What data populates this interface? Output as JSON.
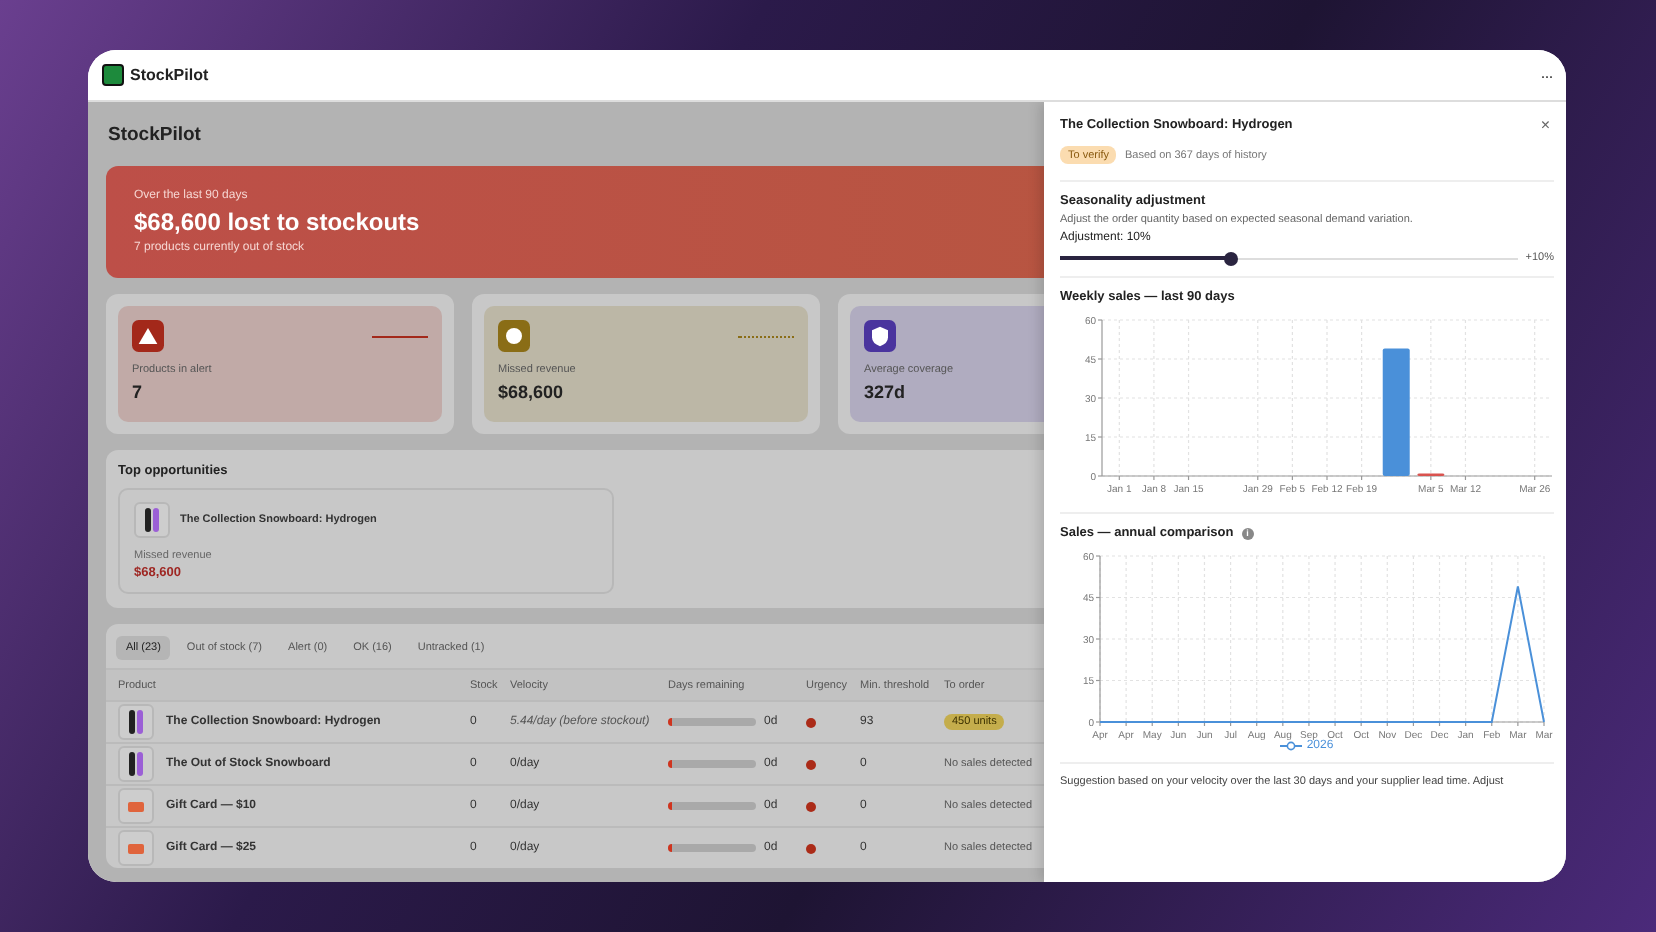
{
  "window": {
    "title": "StockPilot",
    "menu": "···"
  },
  "page": {
    "title": "StockPilot"
  },
  "hero": {
    "eyebrow": "Over the last 90 days",
    "headline": "$68,600 lost to stockouts",
    "subtitle": "7 products currently out of stock"
  },
  "stats": [
    {
      "kind": "alert",
      "label": "Products in alert",
      "value": "7",
      "color": "#a3281a"
    },
    {
      "kind": "revenue",
      "label": "Missed revenue",
      "value": "$68,600",
      "color": "#8a6d16"
    },
    {
      "kind": "coverage",
      "label": "Average coverage",
      "value": "327d",
      "color": "#4a349e"
    }
  ],
  "opportunities": {
    "title": "Top opportunities",
    "items": [
      {
        "product": "The Collection Snowboard: Hydrogen",
        "metric_label": "Missed revenue",
        "metric_value": "$68,600"
      }
    ]
  },
  "filters": [
    {
      "label": "All (23)",
      "selected": true
    },
    {
      "label": "Out of stock (7)",
      "selected": false
    },
    {
      "label": "Alert (0)",
      "selected": false
    },
    {
      "label": "OK (16)",
      "selected": false
    },
    {
      "label": "Untracked (1)",
      "selected": false
    }
  ],
  "table": {
    "columns": [
      "Product",
      "Stock",
      "Velocity",
      "Days remaining",
      "Urgency",
      "Min. threshold",
      "To order"
    ],
    "rows": [
      {
        "kind": "snowboard",
        "product": "The Collection Snowboard: Hydrogen",
        "stock": "0",
        "velocity": "5.44/day (before stockout)",
        "estimated": true,
        "level": 0.04,
        "days": "0d",
        "color": "#ab2b18",
        "threshold": "93",
        "to_order": {
          "kind": "badge",
          "text": "450 units"
        }
      },
      {
        "kind": "snowboard",
        "product": "The Out of Stock Snowboard",
        "stock": "0",
        "velocity": "0/day",
        "estimated": false,
        "level": 0.04,
        "days": "0d",
        "color": "#ab2b18",
        "threshold": "0",
        "to_order": {
          "kind": "note",
          "text": "No sales detected"
        }
      },
      {
        "kind": "giftcard",
        "product": "Gift Card — $10",
        "stock": "0",
        "velocity": "0/day",
        "estimated": false,
        "level": 0.04,
        "days": "0d",
        "color": "#ab2b18",
        "threshold": "0",
        "to_order": {
          "kind": "note",
          "text": "No sales detected"
        }
      },
      {
        "kind": "giftcard",
        "product": "Gift Card — $25",
        "stock": "0",
        "velocity": "0/day",
        "estimated": false,
        "level": 0.04,
        "days": "0d",
        "color": "#ab2b18",
        "threshold": "0",
        "to_order": {
          "kind": "note",
          "text": "No sales detected"
        }
      }
    ]
  },
  "panel": {
    "title": "The Collection Snowboard: Hydrogen",
    "close": "×",
    "badge": "To verify",
    "history": "Based on 367 days of history",
    "seasonality": {
      "title": "Seasonality adjustment",
      "description": "Adjust the order quantity based on expected seasonal demand variation.",
      "label": "Adjustment: 10%",
      "level": 0.375,
      "reading": "+10%"
    },
    "weekly": {
      "title": "Weekly sales — last 90 days",
      "chart_data": {
        "type": "bar",
        "grid": true,
        "categories": [
          "Jan 1",
          "Jan 8",
          "Jan 15",
          null,
          "Jan 29",
          "Feb 5",
          "Feb 12",
          "Feb 19",
          null,
          "Mar 5",
          "Mar 12",
          null,
          "Mar 26"
        ],
        "ylim": [
          0,
          60
        ],
        "yticks": [
          0,
          15,
          30,
          45,
          60
        ],
        "series": [
          {
            "color": "#4a90d9",
            "values": [
              0,
              0,
              0,
              0,
              0,
              0,
              0,
              0,
              49,
              null,
              0,
              0,
              0
            ]
          },
          {
            "color": "#d9534f",
            "values": [
              null,
              null,
              null,
              null,
              null,
              null,
              null,
              null,
              null,
              1,
              null,
              null,
              null
            ]
          }
        ]
      }
    },
    "annual": {
      "title": "Sales — annual comparison",
      "info": "i",
      "chart_data": {
        "type": "line",
        "grid": true,
        "categories": [
          "Apr",
          "Apr",
          "May",
          "Jun",
          "Jun",
          "Jul",
          "Aug",
          "Aug",
          "Sep",
          "Oct",
          "Oct",
          "Nov",
          "Dec",
          "Dec",
          "Jan",
          "Feb",
          "Mar",
          "Mar"
        ],
        "ylim": [
          0,
          60
        ],
        "yticks": [
          0,
          15,
          30,
          45,
          60
        ],
        "series": [
          {
            "name": "2026",
            "color": "#4a90d9",
            "values": [
              0,
              0,
              0,
              0,
              0,
              0,
              0,
              0,
              0,
              0,
              0,
              0,
              0,
              0,
              0,
              0,
              49,
              0
            ]
          }
        ]
      }
    },
    "suggestion": "Suggestion based on your velocity over the last 30 days and your supplier lead time. Adjust"
  }
}
